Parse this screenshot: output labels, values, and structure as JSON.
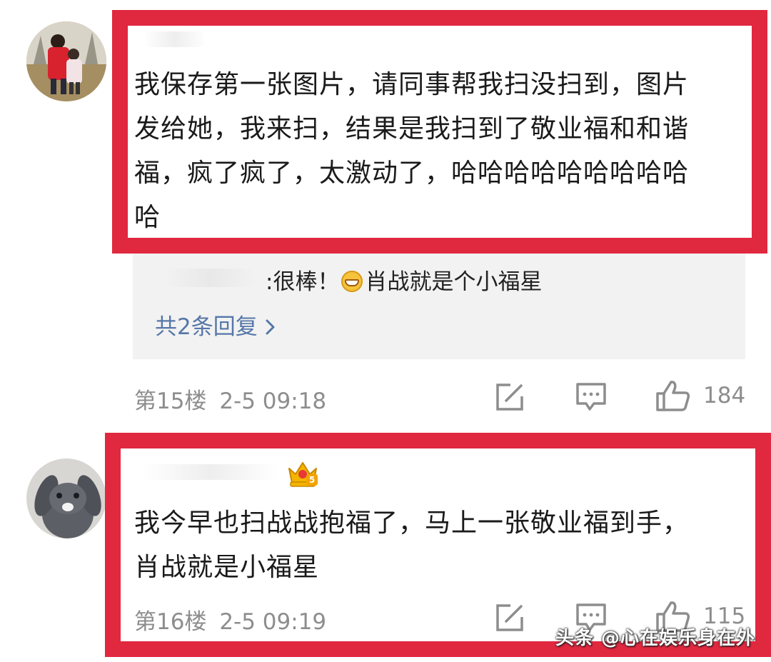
{
  "comments": [
    {
      "floor_label": "第15楼",
      "time": "2-5 09:18",
      "text": "我保存第一张图片，请同事帮我扫没扫到，图片\n发给她，我来扫，结果是我扫到了敬业福和和谐\n福，疯了疯了，太激动了，哈哈哈哈哈哈哈哈哈\n哈",
      "reply_preview": {
        "prefix": ":很棒！",
        "suffix": "肖战就是个小福星",
        "emoji": "grin-emoji"
      },
      "more_replies_label": "共2条回复",
      "like_count": "184"
    },
    {
      "floor_label": "第16楼",
      "time": "2-5 09:19",
      "badge": "5",
      "text": "我今早也扫战战抱福了，马上一张敬业福到手，\n肖战就是小福星",
      "like_count": "115"
    }
  ],
  "icons": {
    "edit": "edit-icon",
    "comment": "comment-icon",
    "like": "thumbs-up-icon",
    "chevron": "chevron-right-icon",
    "crown": "crown-badge-icon"
  },
  "colors": {
    "highlight": "#e0283f",
    "link": "#5677a8",
    "meta": "#8d8d8d",
    "text": "#1a1a1a",
    "reply_bg": "#f2f2f2"
  },
  "watermark": "头条 @心在娱乐身在外"
}
